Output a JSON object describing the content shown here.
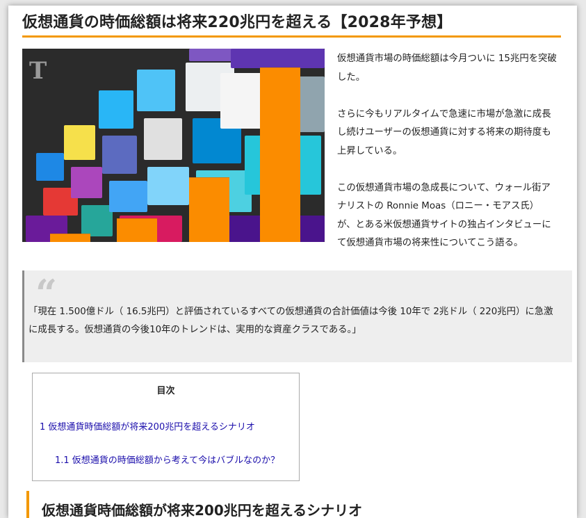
{
  "article": {
    "title": "仮想通貨の時価総額は将来220兆円を超える【2028年予想】",
    "intro": [
      "仮想通貨市場の時価総額は今月ついに 15兆円を突破した。",
      "さらに今もリアルタイムで急速に市場が急激に成長し続けユーザーの仮想通貨に対する将来の期待度も上昇している。",
      "この仮想通貨市場の急成長について、ウォール街アナリストの Ronnie Moas（ロニー・モアス氏）が、とある米仮想通貨サイトの独占インタビューにて仮想通貨市場の将来性についてこう語る。"
    ],
    "quote": {
      "text": "「現在 1.500億ドル（ 16.5兆円）と評価されているすべての仮想通貨の合計価値は今後 10年で 2兆ドル（ 220兆円）に急激に成長する。仮想通貨の今後10年のトレンドは、実用的な資産クラスである。」"
    },
    "toc": {
      "title": "目次",
      "items": [
        "1 仮想通貨時価総額が将来200兆円を超えるシナリオ",
        "1.1 仮想通貨の時価総額から考えて今はバブルなのか？"
      ]
    },
    "section_heading": "仮想通貨時価総額が将来200兆円を超えるシナリオ"
  },
  "hero": {
    "logo_letter": "T",
    "accent_color": "#fb8c00",
    "growth_bars": [
      0.04,
      0.12,
      0.33,
      0.9
    ]
  }
}
